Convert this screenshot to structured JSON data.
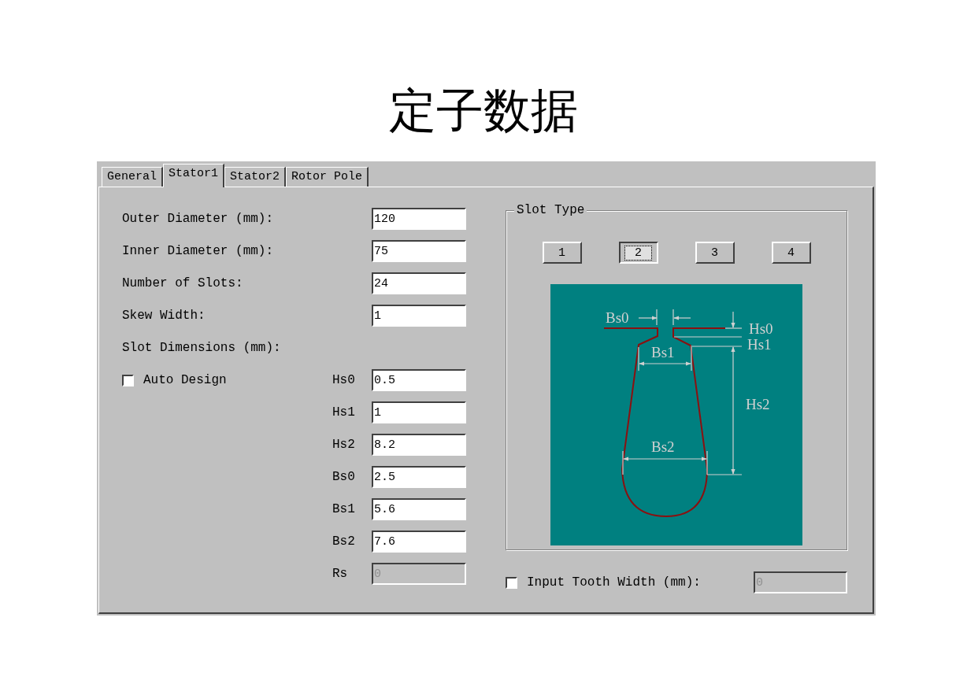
{
  "title": "定子数据",
  "tabs": [
    {
      "label": "General",
      "selected": false
    },
    {
      "label": "Stator1",
      "selected": true
    },
    {
      "label": "Stator2",
      "selected": false
    },
    {
      "label": "Rotor Pole",
      "selected": false
    }
  ],
  "fields": [
    {
      "label": "Outer Diameter (mm):",
      "value": "120"
    },
    {
      "label": "Inner Diameter (mm):",
      "value": "75"
    },
    {
      "label": "Number of Slots:",
      "value": "24"
    },
    {
      "label": "Skew Width:",
      "value": "1"
    }
  ],
  "slot_dimensions_label": "Slot Dimensions (mm):",
  "auto_design": {
    "label": "Auto Design",
    "checked": false
  },
  "slot_fields": [
    {
      "label": "Hs0",
      "value": "0.5",
      "disabled": false
    },
    {
      "label": "Hs1",
      "value": "1",
      "disabled": false
    },
    {
      "label": "Hs2",
      "value": "8.2",
      "disabled": false
    },
    {
      "label": "Bs0",
      "value": "2.5",
      "disabled": false
    },
    {
      "label": "Bs1",
      "value": "5.6",
      "disabled": false
    },
    {
      "label": "Bs2",
      "value": "7.6",
      "disabled": false
    },
    {
      "label": "Rs",
      "value": "0",
      "disabled": true
    }
  ],
  "slot_type": {
    "label": "Slot Type",
    "buttons": [
      {
        "label": "1",
        "selected": false
      },
      {
        "label": "2",
        "selected": true
      },
      {
        "label": "3",
        "selected": false
      },
      {
        "label": "4",
        "selected": false
      }
    ]
  },
  "diagram": {
    "labels": [
      "Bs0",
      "Hs0",
      "Hs1",
      "Bs1",
      "Hs2",
      "Bs2"
    ]
  },
  "tooth_width": {
    "label": "Input Tooth Width (mm):",
    "checked": false,
    "value": "0",
    "disabled": true
  }
}
